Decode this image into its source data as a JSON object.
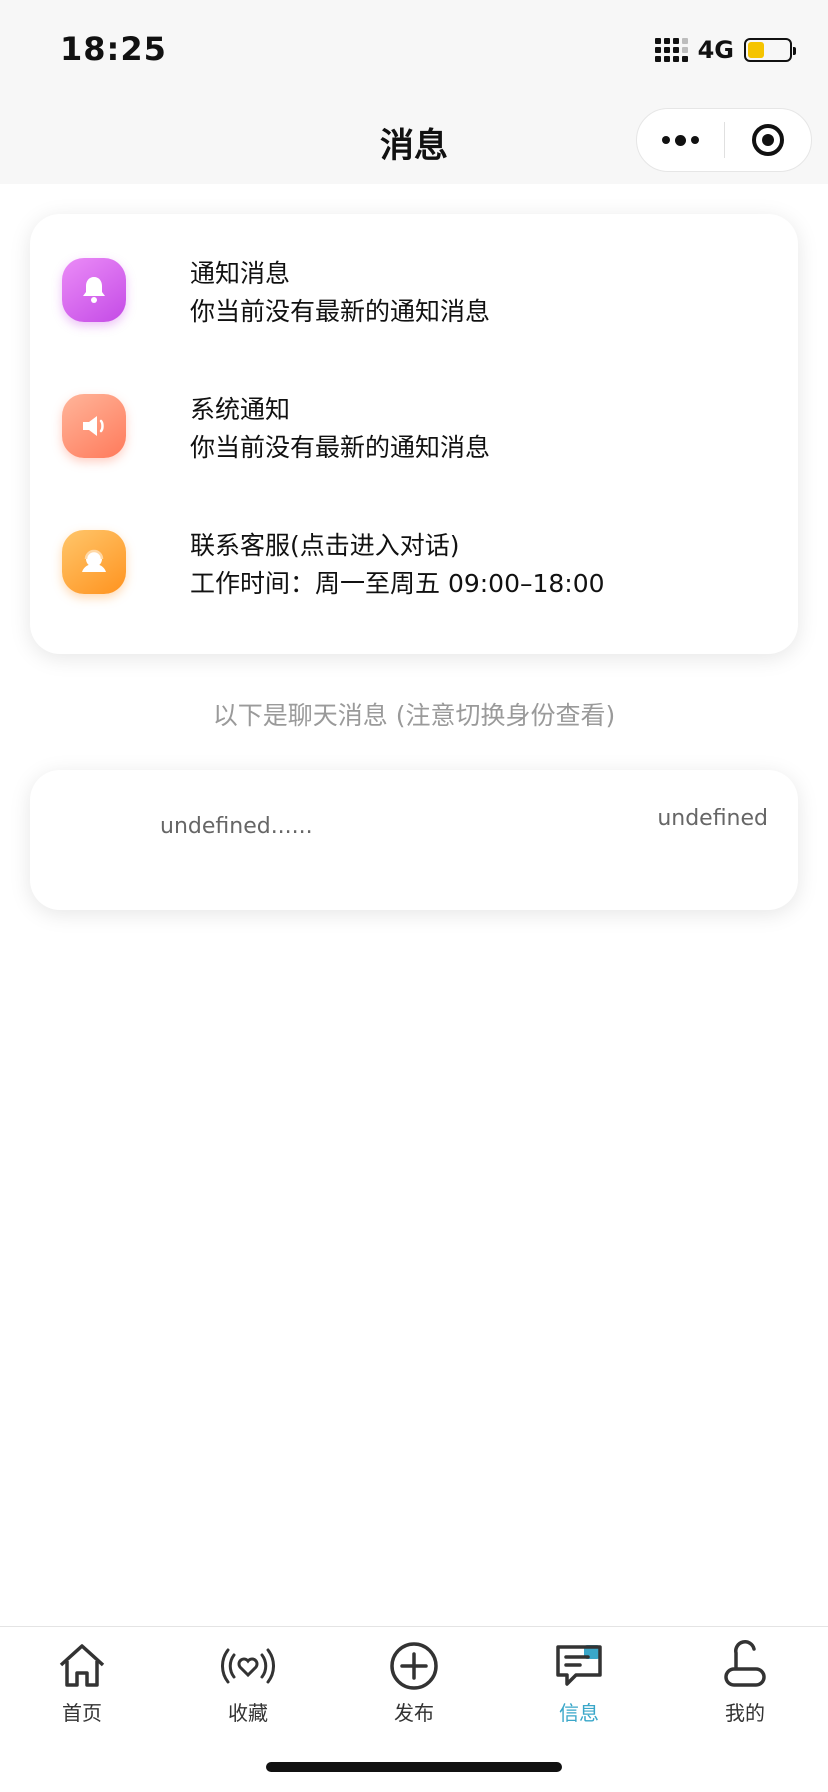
{
  "status_bar": {
    "time": "18:25",
    "network": "4G",
    "battery_color": "#f5c400"
  },
  "nav": {
    "title": "消息",
    "more_icon": "more-dots-icon",
    "close_icon": "target-icon"
  },
  "notifications": [
    {
      "title": "通知消息",
      "subtitle": "你当前没有最新的通知消息",
      "icon": "bell-icon",
      "color": "#d35fee"
    },
    {
      "title": "系统通知",
      "subtitle": "你当前没有最新的通知消息",
      "icon": "speaker-icon",
      "color": "#ff8a6a"
    },
    {
      "title": "联系客服(点击进入对话)",
      "subtitle": "工作时间：周一至周五 09:00–18:00",
      "icon": "headset-icon",
      "color": "#ffa733"
    }
  ],
  "divider_text": "以下是聊天消息 (注意切换身份查看)",
  "chat": {
    "preview": "undefined......",
    "time": "undefined"
  },
  "tabs": [
    {
      "label": "首页",
      "icon": "home-icon",
      "active": false
    },
    {
      "label": "收藏",
      "icon": "heart-broadcast-icon",
      "active": false
    },
    {
      "label": "发布",
      "icon": "plus-circle-icon",
      "active": false
    },
    {
      "label": "信息",
      "icon": "message-icon",
      "active": true
    },
    {
      "label": "我的",
      "icon": "user-icon",
      "active": false
    }
  ],
  "accent_color": "#3aa7c9"
}
